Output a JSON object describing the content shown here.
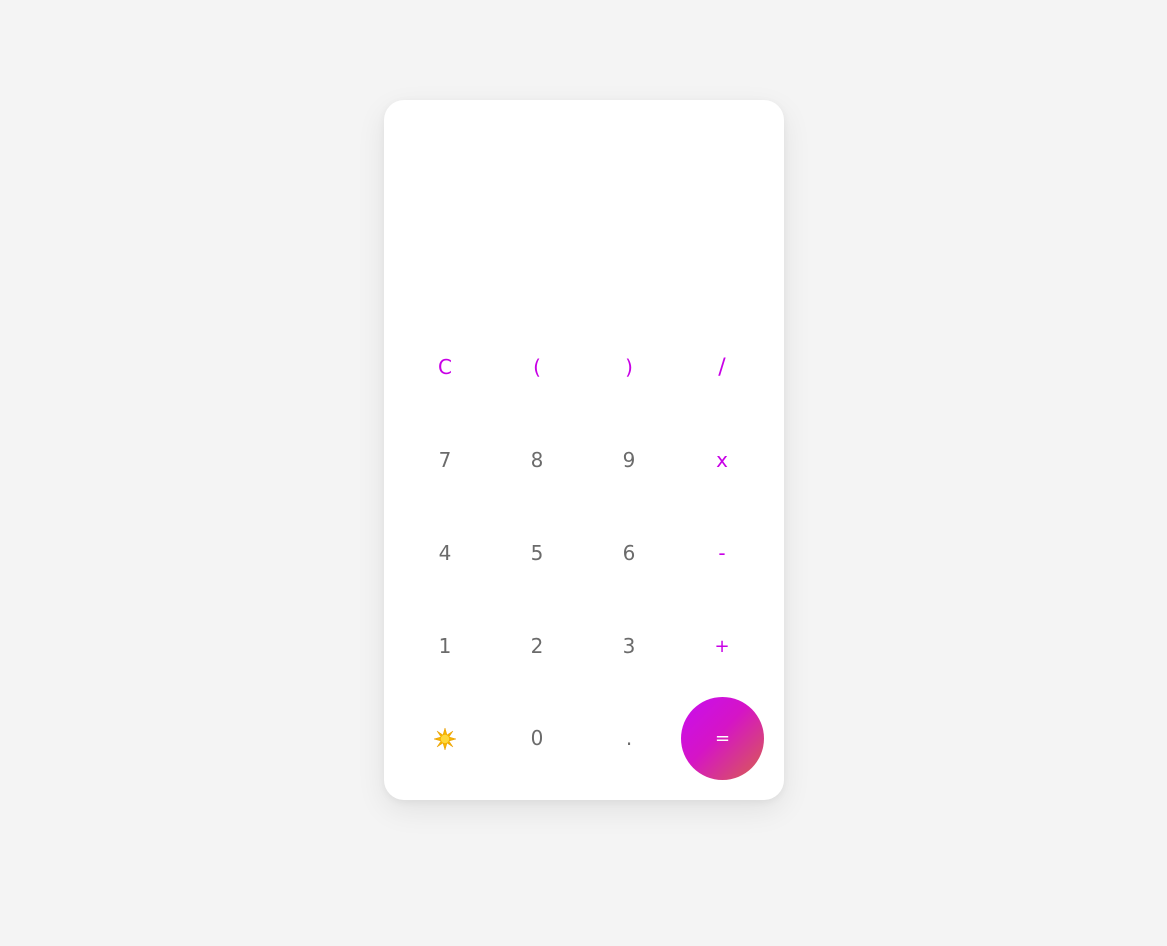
{
  "display": {
    "value": ""
  },
  "keypad": {
    "row1": {
      "clear": "C",
      "open_paren": "(",
      "close_paren": ")",
      "divide": "/"
    },
    "row2": {
      "seven": "7",
      "eight": "8",
      "nine": "9",
      "multiply": "x"
    },
    "row3": {
      "four": "4",
      "five": "5",
      "six": "6",
      "minus": "-"
    },
    "row4": {
      "one": "1",
      "two": "2",
      "three": "3",
      "plus": "+"
    },
    "row5": {
      "theme_icon": "sun-icon",
      "zero": "0",
      "decimal": ".",
      "equals": "="
    }
  },
  "colors": {
    "operator": "#c800e6",
    "number": "#6b6b6b",
    "equals_gradient_start": "#c80ef0",
    "equals_gradient_end": "#d8604c",
    "background": "#f4f4f4",
    "card": "#ffffff"
  }
}
